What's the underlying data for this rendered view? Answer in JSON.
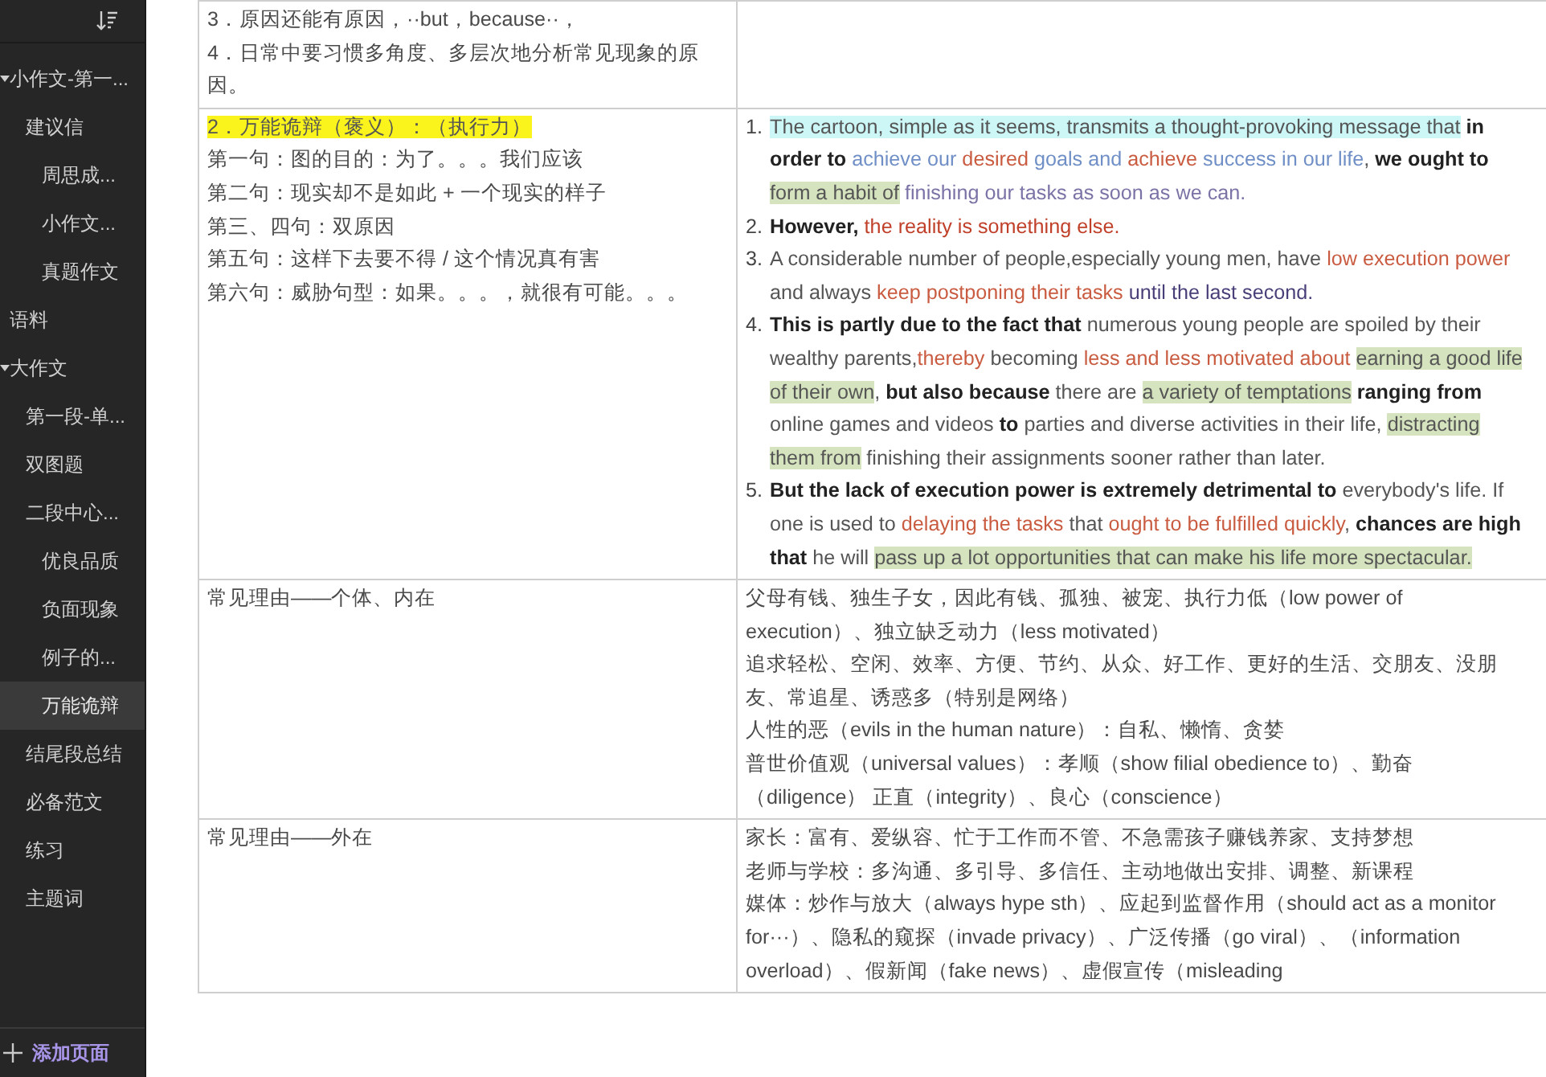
{
  "sidebar": {
    "items": [
      {
        "label": "小作文-第一...",
        "selected": false,
        "expanded": true,
        "children": [
          {
            "label": "建议信",
            "selected": false,
            "children": [
              {
                "label": "周思成...",
                "selected": false
              },
              {
                "label": "小作文...",
                "selected": false
              },
              {
                "label": "真题作文",
                "selected": false
              }
            ]
          }
        ]
      },
      {
        "label": "语料",
        "selected": false
      },
      {
        "label": "大作文",
        "selected": false,
        "expanded": true,
        "children": [
          {
            "label": "第一段-单...",
            "selected": false
          },
          {
            "label": "双图题",
            "selected": false
          },
          {
            "label": "二段中心...",
            "selected": false,
            "children": [
              {
                "label": "优良品质",
                "selected": false
              },
              {
                "label": "负面现象",
                "selected": false
              },
              {
                "label": "例子的...",
                "selected": false
              },
              {
                "label": "万能诡辩",
                "selected": true
              }
            ]
          },
          {
            "label": "结尾段总结",
            "selected": false
          },
          {
            "label": "必备范文",
            "selected": false
          },
          {
            "label": "练习",
            "selected": false
          },
          {
            "label": "主题词",
            "selected": false
          }
        ]
      }
    ],
    "add_button": "添加页面"
  },
  "table": {
    "rows": [
      {
        "left": {
          "lines": [
            "3．原因还能有原因，··but，because··，",
            "4．日常中要习惯多角度、多层次地分析常见现象的原因。"
          ]
        },
        "right": {
          "kind": "empty"
        }
      },
      {
        "left": {
          "heading": {
            "text": "2．万能诡辩（褒义）：（执行力）",
            "highlighted": true
          },
          "lines": [
            "第一句：图的目的：为了。。。我们应该",
            "第二句：现实却不是如此 + 一个现实的样子",
            "第三、四句：双原因",
            "第五句：这样下去要不得 / 这个情况真有害",
            "第六句：威胁句型：如果。。。，就很有可能。。。"
          ]
        },
        "right": {
          "kind": "numbered",
          "items": [
            {
              "number": "1.",
              "segments": [
                {
                  "text": "The cartoon, simple as it seems, transmits a thought-provoking message that",
                  "bold": false,
                  "color": "#555555",
                  "kind": "cyan-highlight"
                },
                {
                  "text": " in order to",
                  "bold": true,
                  "color": "#222222",
                  "kind": "plain"
                },
                {
                  "text": " achieve our",
                  "bold": false,
                  "color": "#6f8fc6",
                  "kind": "plain"
                },
                {
                  "text": " desired",
                  "bold": false,
                  "color": "#c95b40",
                  "kind": "plain"
                },
                {
                  "text": " goals and",
                  "bold": false,
                  "color": "#6f8fc6",
                  "kind": "plain"
                },
                {
                  "text": " achieve",
                  "bold": false,
                  "color": "#c95b40",
                  "kind": "plain"
                },
                {
                  "text": " success in our life",
                  "bold": false,
                  "color": "#6f8fc6",
                  "kind": "plain"
                },
                {
                  "text": ",",
                  "bold": false,
                  "color": "#555555",
                  "kind": "plain"
                },
                {
                  "text": " we ought to ",
                  "bold": true,
                  "color": "#222222",
                  "kind": "plain"
                },
                {
                  "text": "form a habit of",
                  "bold": false,
                  "color": "#555555",
                  "kind": "green-highlight"
                },
                {
                  "text": " finishing our tasks as soon as we can.",
                  "bold": false,
                  "color": "#7b72a6",
                  "kind": "plain"
                }
              ]
            },
            {
              "number": "2.",
              "segments": [
                {
                  "text": "However,",
                  "bold": true,
                  "color": "#222222",
                  "kind": "plain"
                },
                {
                  "text": " the reality is something else.",
                  "bold": false,
                  "color": "#c0402a",
                  "kind": "plain"
                }
              ]
            },
            {
              "number": "3.",
              "segments": [
                {
                  "text": "A considerable number of people,especially young men, have ",
                  "bold": false,
                  "color": "#555555",
                  "kind": "plain"
                },
                {
                  "text": "low execution power",
                  "bold": false,
                  "color": "#c95b40",
                  "kind": "plain"
                },
                {
                  "text": " and always ",
                  "bold": false,
                  "color": "#555555",
                  "kind": "plain"
                },
                {
                  "text": "keep postponing their tasks",
                  "bold": false,
                  "color": "#c95b40",
                  "kind": "plain"
                },
                {
                  "text": " until the last second.",
                  "bold": false,
                  "color": "#4a3e78",
                  "kind": "plain"
                }
              ]
            },
            {
              "number": "4.",
              "segments": [
                {
                  "text": "This is partly due to the fact that",
                  "bold": true,
                  "color": "#222222",
                  "kind": "plain"
                },
                {
                  "text": " numerous young people are spoiled by their wealthy parents,",
                  "bold": false,
                  "color": "#555555",
                  "kind": "plain"
                },
                {
                  "text": "thereby",
                  "bold": false,
                  "color": "#c95b40",
                  "kind": "plain"
                },
                {
                  "text": " becoming ",
                  "bold": false,
                  "color": "#555555",
                  "kind": "plain"
                },
                {
                  "text": "less and less motivated about ",
                  "bold": false,
                  "color": "#c95b40",
                  "kind": "plain"
                },
                {
                  "text": "earning a good life of their own",
                  "bold": false,
                  "color": "#555555",
                  "kind": "green-highlight"
                },
                {
                  "text": ", ",
                  "bold": false,
                  "color": "#555555",
                  "kind": "plain"
                },
                {
                  "text": "but also because",
                  "bold": true,
                  "color": "#222222",
                  "kind": "plain"
                },
                {
                  "text": " there are ",
                  "bold": false,
                  "color": "#555555",
                  "kind": "plain"
                },
                {
                  "text": "a variety of temptations",
                  "bold": false,
                  "color": "#555555",
                  "kind": "green-highlight"
                },
                {
                  "text": " ranging from",
                  "bold": true,
                  "color": "#222222",
                  "kind": "plain"
                },
                {
                  "text": " online games and videos ",
                  "bold": false,
                  "color": "#555555",
                  "kind": "plain"
                },
                {
                  "text": "to",
                  "bold": true,
                  "color": "#222222",
                  "kind": "plain"
                },
                {
                  "text": " parties and diverse activities in their life, ",
                  "bold": false,
                  "color": "#555555",
                  "kind": "plain"
                },
                {
                  "text": "distracting them from",
                  "bold": false,
                  "color": "#555555",
                  "kind": "green-highlight"
                },
                {
                  "text": " finishing their assignments sooner rather than later.",
                  "bold": false,
                  "color": "#555555",
                  "kind": "plain"
                }
              ]
            },
            {
              "number": "5.",
              "segments": [
                {
                  "text": "But the lack of execution power is extremely detrimental to",
                  "bold": true,
                  "color": "#222222",
                  "kind": "plain"
                },
                {
                  "text": " everybody's life. If one is used to ",
                  "bold": false,
                  "color": "#555555",
                  "kind": "plain"
                },
                {
                  "text": "delaying the tasks",
                  "bold": false,
                  "color": "#c95b40",
                  "kind": "plain"
                },
                {
                  "text": " that ",
                  "bold": false,
                  "color": "#555555",
                  "kind": "plain"
                },
                {
                  "text": "ought to be fulfilled quickly",
                  "bold": false,
                  "color": "#c95b40",
                  "kind": "plain"
                },
                {
                  "text": ", ",
                  "bold": false,
                  "color": "#555555",
                  "kind": "plain"
                },
                {
                  "text": "chances are high that",
                  "bold": true,
                  "color": "#222222",
                  "kind": "plain"
                },
                {
                  "text": " he will ",
                  "bold": false,
                  "color": "#555555",
                  "kind": "plain"
                },
                {
                  "text": "pass up a lot opportunities that can make his life more spectacular.",
                  "bold": false,
                  "color": "#555555",
                  "kind": "green-highlight"
                }
              ]
            }
          ]
        }
      },
      {
        "left": {
          "lines": [
            "常见理由——个体、内在"
          ]
        },
        "right": {
          "kind": "lines",
          "lines": [
            "父母有钱、独生子女，因此有钱、孤独、被宠、执行力低（low power of execution）、独立缺乏动力（less motivated）",
            "追求轻松、空闲、效率、方便、节约、从众、好工作、更好的生活、交朋友、没朋友、常追星、诱惑多（特别是网络）",
            "人性的恶（evils in the human nature）：自私、懒惰、贪婪",
            "普世价值观（universal values）：孝顺（show filial obedience to）、勤奋（diligence） 正直（integrity）、良心（conscience）"
          ]
        }
      },
      {
        "left": {
          "lines": [
            "常见理由——外在"
          ]
        },
        "right": {
          "kind": "lines",
          "lines": [
            "家长：富有、爱纵容、忙于工作而不管、不急需孩子赚钱养家、支持梦想",
            "老师与学校：多沟通、多引导、多信任、主动地做出安排、调整、新课程",
            "媒体：炒作与放大（always hype sth）、应起到监督作用（should act as a monitor for···）、隐私的窥探（invade privacy）、广泛传播（go viral）、（information overload）、假新闻（fake news）、虚假宣传（misleading"
          ]
        }
      }
    ]
  }
}
